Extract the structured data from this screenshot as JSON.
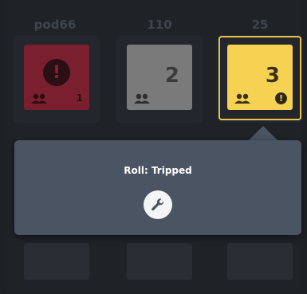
{
  "columns": [
    {
      "label": "pod66"
    },
    {
      "label": "110"
    },
    {
      "label": "25"
    }
  ],
  "tiles": [
    {
      "color": "#7a1f2e",
      "status": "alert",
      "count": "1",
      "icon": "people-icon"
    },
    {
      "color": "#7a7a7a",
      "number": "2",
      "icon": "people-icon"
    },
    {
      "color": "#f6d152",
      "number": "3",
      "icon": "people-icon",
      "selected": true
    }
  ],
  "popover": {
    "title": "Roll: Tripped",
    "action_icon": "wrench-icon"
  }
}
